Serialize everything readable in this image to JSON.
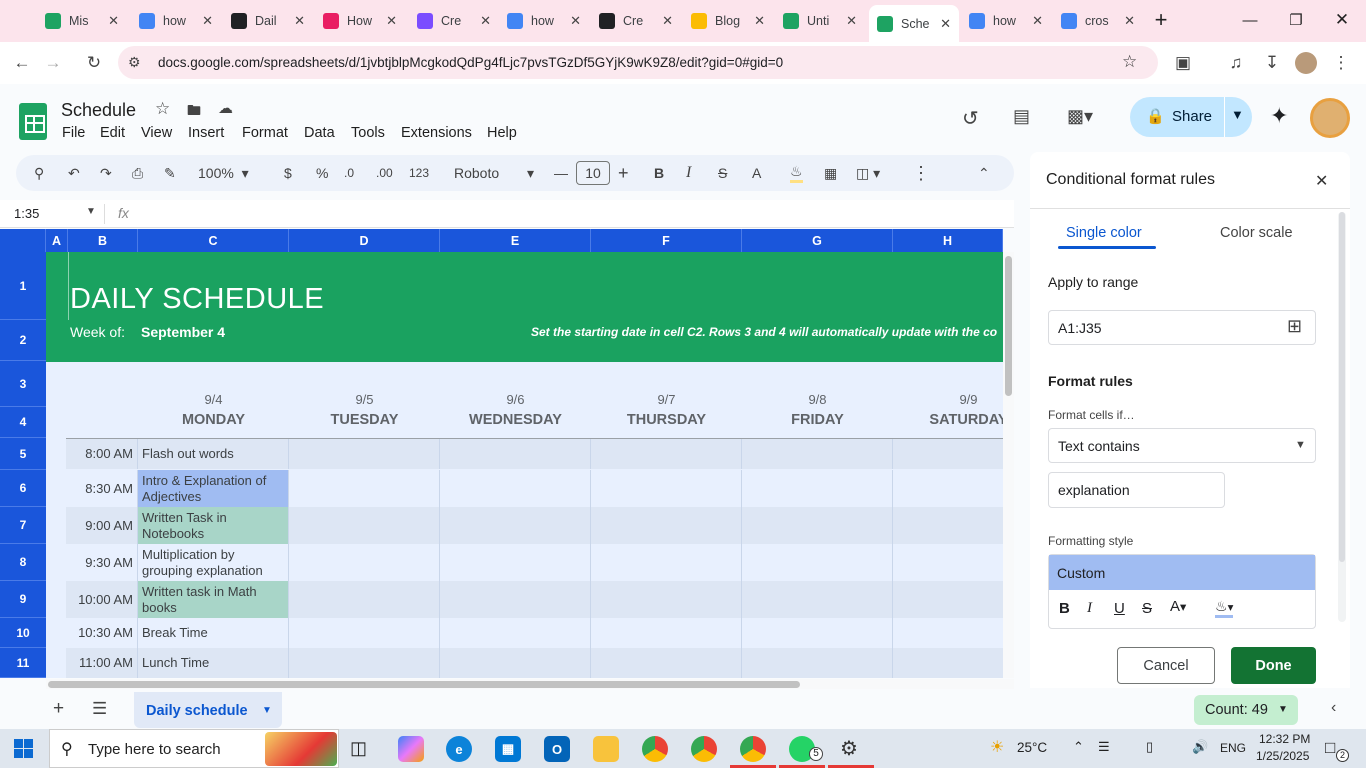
{
  "browser": {
    "tabs": [
      {
        "title": "Mis",
        "icon": "sheets-icon",
        "color": "#1ea362"
      },
      {
        "title": "how",
        "icon": "google-icon",
        "color": "#4285f4"
      },
      {
        "title": "Dail",
        "icon": "openai-icon",
        "color": "#202124"
      },
      {
        "title": "How",
        "icon": "clickup-icon",
        "color": "#e91e63"
      },
      {
        "title": "Cre",
        "icon": "canva-icon",
        "color": "#7b4dff"
      },
      {
        "title": "how",
        "icon": "docs-icon",
        "color": "#4285f4"
      },
      {
        "title": "Cre",
        "icon": "openai-icon",
        "color": "#202124"
      },
      {
        "title": "Blog",
        "icon": "drive-icon",
        "color": "#fbbc04"
      },
      {
        "title": "Unti",
        "icon": "sheets-icon",
        "color": "#1ea362"
      },
      {
        "title": "Sche",
        "icon": "sheets-icon",
        "color": "#1ea362",
        "active": true
      },
      {
        "title": "how",
        "icon": "docs-icon",
        "color": "#4285f4"
      },
      {
        "title": "cros",
        "icon": "google-icon",
        "color": "#4285f4"
      }
    ],
    "url": "docs.google.com/spreadsheets/d/1jvbtjblpMcgkodQdPg4fLjc7pvsTGzDf5GYjK9wK9Z8/edit?gid=0#gid=0"
  },
  "sheets": {
    "title": "Schedule",
    "menu": [
      "File",
      "Edit",
      "View",
      "Insert",
      "Format",
      "Data",
      "Tools",
      "Extensions",
      "Help"
    ],
    "share_label": "Share",
    "toolbar": {
      "zoom": "100%",
      "currency": "$",
      "percent": "%",
      "dec_dec": ".0",
      "dec_inc": ".00",
      "numfmt": "123",
      "font": "Roboto",
      "font_size": "10",
      "bold": "B",
      "italic": "I",
      "text_color": "A"
    },
    "name_box": "1:35",
    "fx": "fx"
  },
  "grid": {
    "columns": [
      "A",
      "B",
      "C",
      "D",
      "E",
      "F",
      "G",
      "H"
    ],
    "rows": [
      "1",
      "2",
      "3",
      "4",
      "5",
      "6",
      "7",
      "8",
      "9",
      "10",
      "11"
    ],
    "banner_title": "DAILY SCHEDULE",
    "week_label": "Week of:",
    "week_value": "September 4",
    "instructions": "Set the starting date in cell C2. Rows 3 and 4 will automatically update with the co",
    "dates": [
      "9/4",
      "9/5",
      "9/6",
      "9/7",
      "9/8",
      "9/9"
    ],
    "days": [
      "MONDAY",
      "TUESDAY",
      "WEDNESDAY",
      "THURSDAY",
      "FRIDAY",
      "SATURDAY"
    ],
    "times": [
      "8:00 AM",
      "8:30 AM",
      "9:00 AM",
      "9:30 AM",
      "10:00 AM",
      "10:30 AM",
      "11:00 AM"
    ],
    "tasks": [
      "Flash out words",
      "Intro & Explanation of Adjectives",
      "Written Task in Notebooks",
      "Multiplication by grouping explanation",
      "Written task in Math books",
      "Break Time",
      "Lunch Time"
    ],
    "highlight_colors": {
      "banner": "#1aa260",
      "blue_highlight": "#a0bcf2",
      "teal_highlight": "#a8d5c8"
    }
  },
  "panel": {
    "title": "Conditional format rules",
    "tabs": [
      "Single color",
      "Color scale"
    ],
    "apply_label": "Apply to range",
    "range_value": "A1:J35",
    "rules_label": "Format rules",
    "cells_if_label": "Format cells if…",
    "condition": "Text contains",
    "condition_value": "explanation",
    "style_label": "Formatting style",
    "style_value": "Custom",
    "cancel_label": "Cancel",
    "done_label": "Done"
  },
  "footer": {
    "sheet_tab": "Daily schedule",
    "count": "Count: 49"
  },
  "taskbar": {
    "search_placeholder": "Type here to search",
    "weather": "25°C",
    "lang": "ENG",
    "time": "12:32 PM",
    "date": "1/25/2025",
    "whatsapp_badge": "5",
    "notif_badge": "2"
  }
}
